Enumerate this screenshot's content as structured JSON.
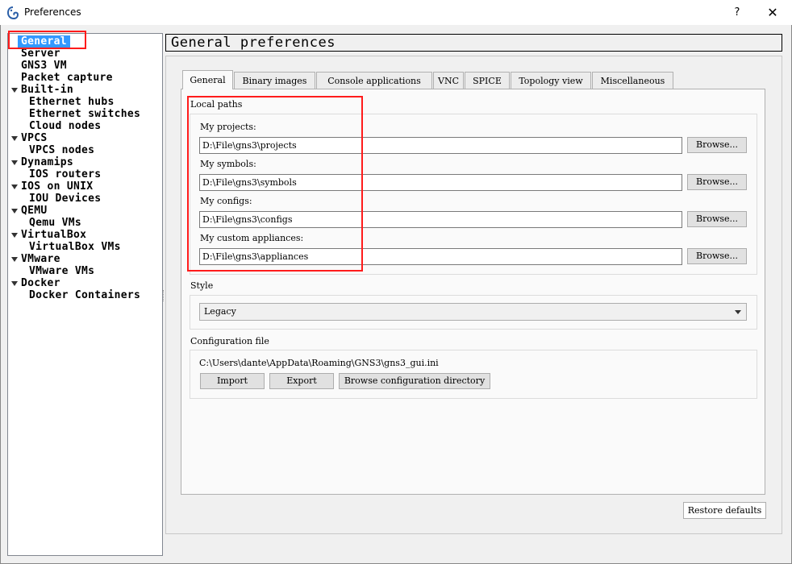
{
  "window": {
    "title": "Preferences",
    "help_label": "?",
    "close_label": "✕",
    "icon": "gns3-chameleon-icon"
  },
  "sidebar": {
    "items": [
      {
        "label": "General",
        "level": 0,
        "expanded": null,
        "selected": true
      },
      {
        "label": "Server",
        "level": 0,
        "expanded": null
      },
      {
        "label": "GNS3 VM",
        "level": 0,
        "expanded": null
      },
      {
        "label": "Packet capture",
        "level": 0,
        "expanded": null
      },
      {
        "label": "Built-in",
        "level": 0,
        "expanded": true
      },
      {
        "label": "Ethernet hubs",
        "level": 1
      },
      {
        "label": "Ethernet switches",
        "level": 1
      },
      {
        "label": "Cloud nodes",
        "level": 1
      },
      {
        "label": "VPCS",
        "level": 0,
        "expanded": true
      },
      {
        "label": "VPCS nodes",
        "level": 1
      },
      {
        "label": "Dynamips",
        "level": 0,
        "expanded": true
      },
      {
        "label": "IOS routers",
        "level": 1
      },
      {
        "label": "IOS on UNIX",
        "level": 0,
        "expanded": true
      },
      {
        "label": "IOU Devices",
        "level": 1
      },
      {
        "label": "QEMU",
        "level": 0,
        "expanded": true
      },
      {
        "label": "Qemu VMs",
        "level": 1
      },
      {
        "label": "VirtualBox",
        "level": 0,
        "expanded": true
      },
      {
        "label": "VirtualBox VMs",
        "level": 1
      },
      {
        "label": "VMware",
        "level": 0,
        "expanded": true
      },
      {
        "label": "VMware VMs",
        "level": 1
      },
      {
        "label": "Docker",
        "level": 0,
        "expanded": true
      },
      {
        "label": "Docker Containers",
        "level": 1
      }
    ]
  },
  "header": {
    "title": "General preferences"
  },
  "tabs": [
    {
      "label": "General",
      "active": true
    },
    {
      "label": "Binary images"
    },
    {
      "label": "Console applications"
    },
    {
      "label": "VNC"
    },
    {
      "label": "SPICE"
    },
    {
      "label": "Topology view"
    },
    {
      "label": "Miscellaneous"
    }
  ],
  "local_paths": {
    "group_label": "Local paths",
    "fields": [
      {
        "label": "My projects:",
        "value": "D:\\File\\gns3\\projects",
        "button": "Browse..."
      },
      {
        "label": "My symbols:",
        "value": "D:\\File\\gns3\\symbols",
        "button": "Browse..."
      },
      {
        "label": "My configs:",
        "value": "D:\\File\\gns3\\configs",
        "button": "Browse..."
      },
      {
        "label": "My custom appliances:",
        "value": "D:\\File\\gns3\\appliances",
        "button": "Browse..."
      }
    ]
  },
  "style": {
    "group_label": "Style",
    "selected": "Legacy"
  },
  "config_file": {
    "group_label": "Configuration file",
    "path": "C:\\Users\\dante\\AppData\\Roaming\\GNS3\\gns3_gui.ini",
    "import_label": "Import",
    "export_label": "Export",
    "browse_dir_label": "Browse configuration directory"
  },
  "footer": {
    "restore_label": "Restore defaults"
  },
  "colors": {
    "highlight_annotation": "#ff1b1b",
    "selection": "#3399ff"
  }
}
